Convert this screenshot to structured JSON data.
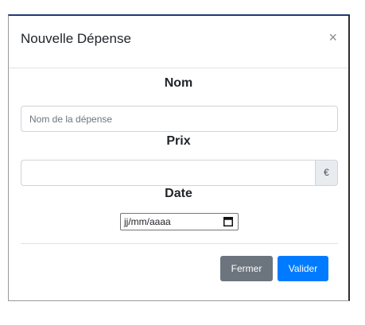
{
  "modal": {
    "title": "Nouvelle Dépense",
    "close_symbol": "×"
  },
  "form": {
    "name_label": "Nom",
    "name_placeholder": "Nom de la dépense",
    "name_value": "",
    "price_label": "Prix",
    "price_value": "",
    "currency_symbol": "€",
    "date_label": "Date",
    "date_placeholder": "jj/mm/aaaa"
  },
  "footer": {
    "close_label": "Fermer",
    "submit_label": "Valider"
  },
  "colors": {
    "primary": "#007bff",
    "secondary": "#6c757d"
  },
  "icons": {
    "close": "close-icon",
    "calendar": "calendar-icon"
  }
}
